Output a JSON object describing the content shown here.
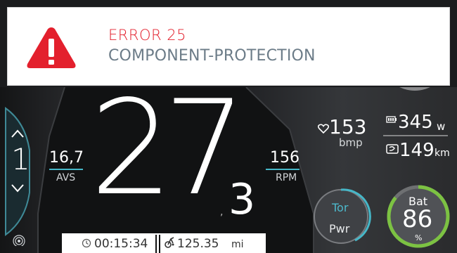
{
  "error": {
    "code": "ERROR 25",
    "message": "COMPONENT-PROTECTION"
  },
  "gear": {
    "value": "1"
  },
  "avs": {
    "value": "16,7",
    "label": "AVS"
  },
  "rpm": {
    "value": "156",
    "label": "RPM"
  },
  "speed": {
    "main": "27",
    "separator": ",",
    "decimal": "3"
  },
  "heart": {
    "value": "153",
    "unit": "bmp"
  },
  "power": {
    "value": "345",
    "unit": "w"
  },
  "range": {
    "value": "149",
    "unit": "km"
  },
  "mode": {
    "top": "Tor",
    "bottom": "Pwr"
  },
  "battery": {
    "label": "Bat",
    "value": "86",
    "unit": "%",
    "level": 0.86
  },
  "trip": {
    "time": "00:15:34",
    "distance": "125.35",
    "distance_unit": "mi"
  },
  "colors": {
    "error_red": "#e3202d",
    "message_gray": "#6c7c88",
    "accent_teal": "#46b7c8",
    "battery_green": "#7cc242"
  },
  "icons": [
    "warning-icon",
    "heart-icon",
    "battery-small-icon",
    "range-icon",
    "clock-icon",
    "bike-icon",
    "signal-icon",
    "chevron-up-icon",
    "chevron-down-icon"
  ]
}
